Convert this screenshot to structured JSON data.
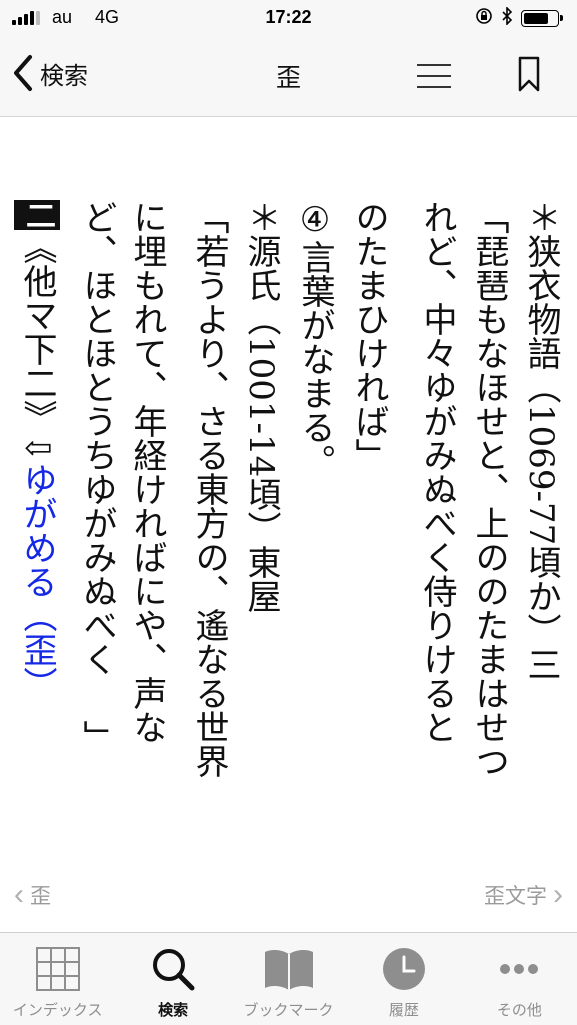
{
  "status_bar": {
    "carrier": "au",
    "network": "4G",
    "time": "17:22",
    "icons": [
      "signal-icon",
      "orientation-lock-icon",
      "bluetooth-icon",
      "battery-icon"
    ],
    "battery_level": 0.8
  },
  "nav": {
    "back_label": "検索",
    "title": "歪",
    "icons": [
      "back-chevron-icon",
      "menu-icon",
      "bookmark-icon"
    ]
  },
  "content": {
    "columns": [
      {
        "text": "＊狭衣物語（1069‐77頃か）三"
      },
      {
        "text": "「琵琶もなほせと、上ののたまはせつ"
      },
      {
        "text": "れど、中々ゆがみぬべく侍りけると"
      },
      {
        "text": "のたまひければ」"
      },
      {
        "circled": "④",
        "text": "言葉がなまる。"
      },
      {
        "text": "＊源氏（1001‐14頃）東屋"
      },
      {
        "text": "「若うより、さる東方の、遙なる世界"
      },
      {
        "text": "に埋もれて、年経ければにや、声な"
      },
      {
        "text": "ど、ほとほとうちゆがみぬべく"
      },
      {
        "text": "」"
      },
      {
        "box": "二",
        "text": "《他マ下二》",
        "arrow": "⇩",
        "link": "ゆがめる（歪）"
      }
    ]
  },
  "page_nav": {
    "prev_label": "歪",
    "next_label": "歪文字"
  },
  "tabs": [
    {
      "label": "インデックス",
      "icon": "grid-icon",
      "active": false
    },
    {
      "label": "検索",
      "icon": "search-icon",
      "active": true
    },
    {
      "label": "ブックマーク",
      "icon": "book-icon",
      "active": false
    },
    {
      "label": "履歴",
      "icon": "clock-icon",
      "active": false
    },
    {
      "label": "その他",
      "icon": "more-icon",
      "active": false
    }
  ],
  "colors": {
    "link": "#1428e6",
    "bar_background": "#f7f7f7",
    "inactive_tab": "#8e8e8e"
  }
}
